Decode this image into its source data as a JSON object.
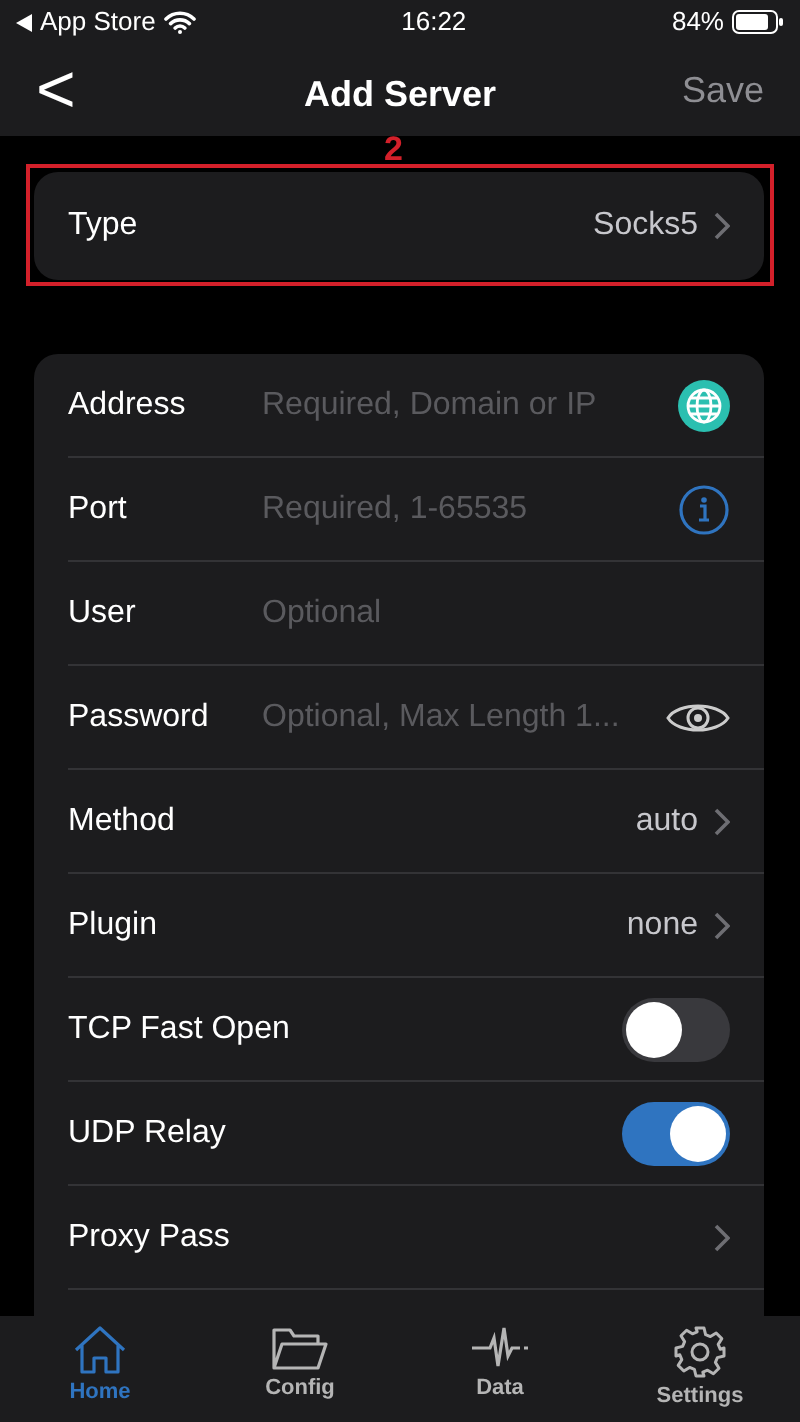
{
  "status_bar": {
    "back_app": "App Store",
    "time": "16:22",
    "battery": "84%"
  },
  "nav": {
    "back": "<",
    "title": "Add Server",
    "action": "Save"
  },
  "annotation": {
    "label": "2"
  },
  "type_row": {
    "label": "Type",
    "value": "Socks5"
  },
  "rows": [
    {
      "kind": "field",
      "label": "Address",
      "placeholder": "Required, Domain or IP"
    },
    {
      "kind": "field",
      "label": "Port",
      "placeholder": "Required, 1-65535"
    },
    {
      "kind": "field",
      "label": "User",
      "placeholder": "Optional"
    },
    {
      "kind": "field",
      "label": "Password",
      "placeholder": "Optional, Max Length 1..."
    },
    {
      "kind": "select",
      "label": "Method",
      "value": "auto"
    },
    {
      "kind": "select",
      "label": "Plugin",
      "value": "none"
    },
    {
      "kind": "toggle",
      "label": "TCP Fast Open",
      "on": false
    },
    {
      "kind": "toggle",
      "label": "UDP Relay",
      "on": true
    },
    {
      "kind": "select",
      "label": "Proxy Pass"
    }
  ],
  "tabs": [
    {
      "label": "Home",
      "selected": true
    },
    {
      "label": "Config",
      "selected": false
    },
    {
      "label": "Data",
      "selected": false
    },
    {
      "label": "Settings",
      "selected": false
    }
  ]
}
